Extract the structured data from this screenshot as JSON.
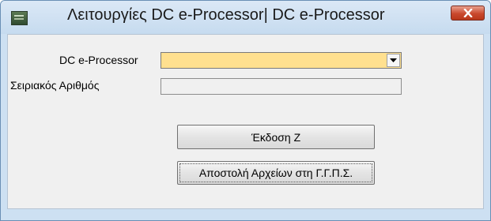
{
  "window": {
    "title": "Λειτουργίες DC e-Processor| DC e-Processor",
    "close_icon": "close-icon",
    "app_icon": "app-icon"
  },
  "form": {
    "processor_label": "DC e-Processor",
    "processor_value": "",
    "serial_label": "Σειριακός Αριθμός",
    "serial_value": ""
  },
  "buttons": {
    "issue_z": "Έκδοση Ζ",
    "send_files": "Αποστολή Αρχείων στη Γ.Γ.Π.Σ."
  },
  "colors": {
    "combo_background": "#ffe08f",
    "close_button": "#c9482d"
  }
}
